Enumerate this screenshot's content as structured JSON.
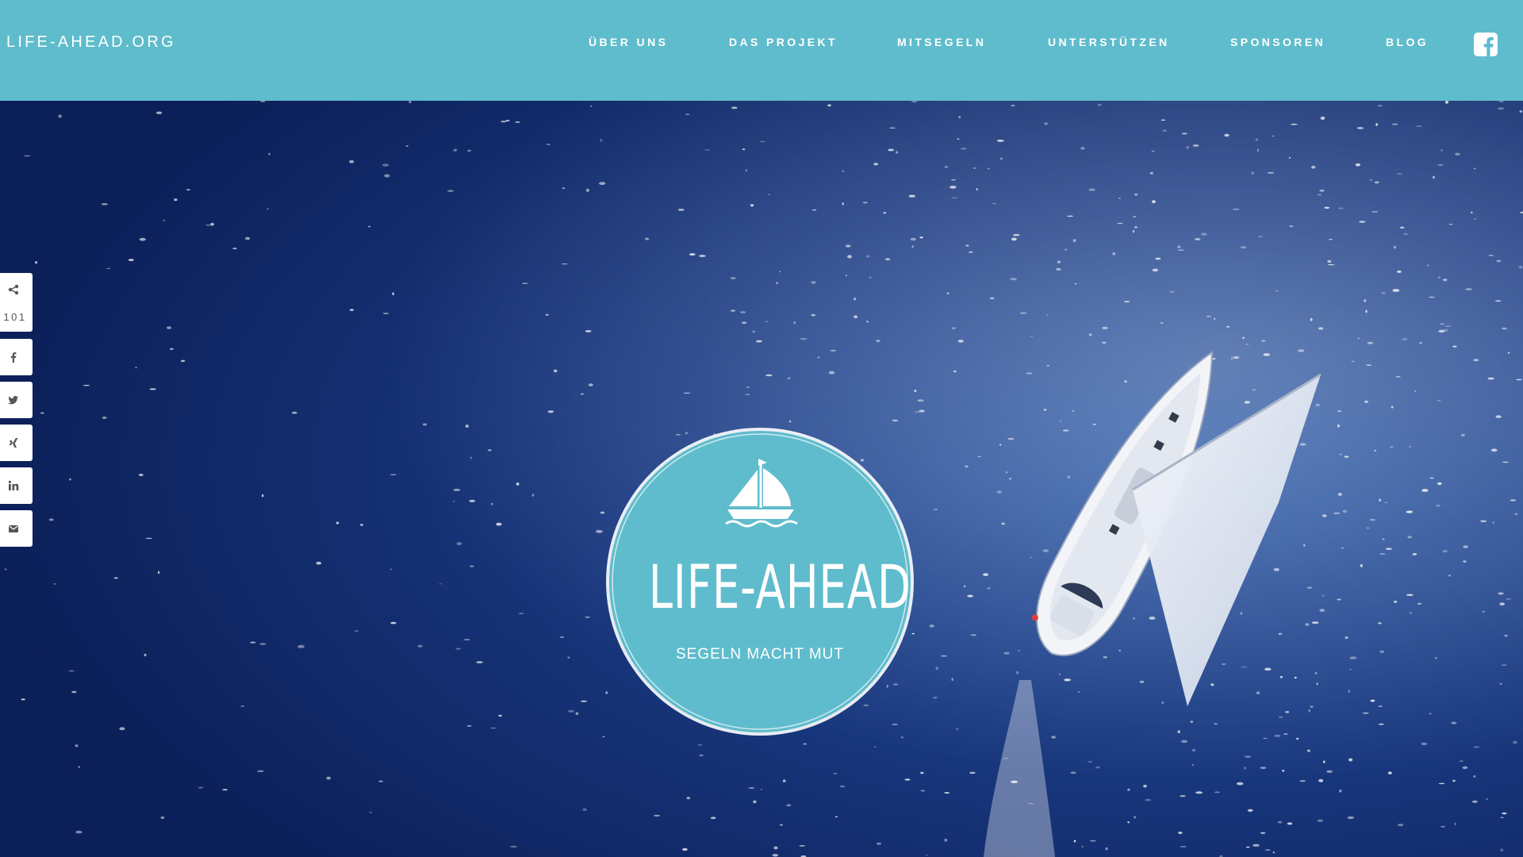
{
  "header": {
    "site_title": "LIFE-AHEAD.ORG",
    "nav": [
      {
        "label": "ÜBER UNS"
      },
      {
        "label": "DAS PROJEKT"
      },
      {
        "label": "MITSEGELN"
      },
      {
        "label": "UNTERSTÜTZEN"
      },
      {
        "label": "SPONSOREN"
      },
      {
        "label": "BLOG"
      }
    ],
    "social_icon": "facebook-square-icon"
  },
  "share": {
    "count": "101",
    "count_icon": "share-icon",
    "buttons": [
      {
        "icon": "facebook-icon"
      },
      {
        "icon": "twitter-icon"
      },
      {
        "icon": "xing-icon"
      },
      {
        "icon": "linkedin-icon"
      },
      {
        "icon": "envelope-icon"
      }
    ]
  },
  "hero": {
    "badge_title": "LIFE-AHEAD",
    "badge_subtitle": "SEGELN MACHT MUT",
    "badge_icon": "sailboat-icon"
  },
  "colors": {
    "header_bg": "#5fbccc",
    "badge_bg": "#5fbccc",
    "ocean_dark": "#0e2462",
    "ocean_light": "#1e4a98",
    "text_white": "#ffffff"
  }
}
